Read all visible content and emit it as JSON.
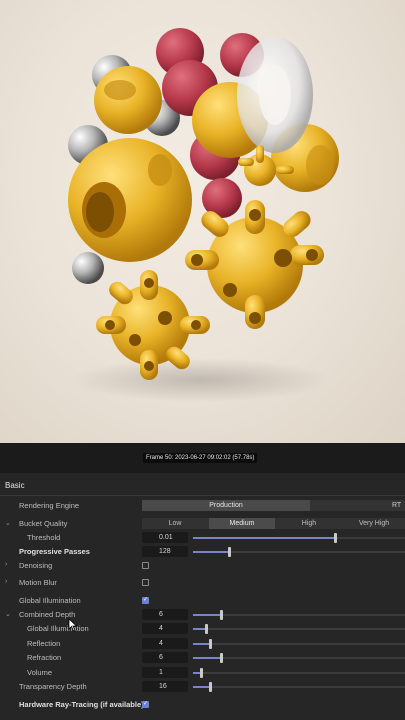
{
  "viewport": {
    "frame_info": "Frame 50: 2023-06-27 09:02:02 (57.78s)"
  },
  "panel": {
    "section_title": "Basic",
    "rendering_engine": {
      "label": "Rendering Engine",
      "value": "Production",
      "alt": "RT"
    },
    "bucket_quality": {
      "label": "Bucket Quality",
      "options": [
        "Low",
        "Medium",
        "High",
        "Very High"
      ],
      "selected": "Medium"
    },
    "threshold": {
      "label": "Threshold",
      "value": "0.01",
      "slider_fraction": 0.67
    },
    "progressive_passes": {
      "label": "Progressive Passes",
      "value": "128",
      "slider_fraction": 0.17
    },
    "denoising": {
      "label": "Denoising",
      "checked": false
    },
    "motion_blur": {
      "label": "Motion Blur",
      "checked": false
    },
    "global_illumination": {
      "label": "Global Illumination",
      "checked": true
    },
    "combined_depth": {
      "label": "Combined Depth",
      "value": "6",
      "slider_fraction": 0.13
    },
    "gi_depth": {
      "label": "Global Illumination",
      "value": "4",
      "slider_fraction": 0.06
    },
    "reflection": {
      "label": "Reflection",
      "value": "4",
      "slider_fraction": 0.08
    },
    "refraction": {
      "label": "Refraction",
      "value": "6",
      "slider_fraction": 0.13
    },
    "volume": {
      "label": "Volume",
      "value": "1",
      "slider_fraction": 0.04
    },
    "transparency_depth": {
      "label": "Transparency Depth",
      "value": "16",
      "slider_fraction": 0.08
    },
    "hardware_rt": {
      "label": "Hardware Ray-Tracing (if available)",
      "checked": true
    }
  },
  "colors": {
    "accent": "#7b84c7",
    "panel_bg": "#262626",
    "yellow": "#e8b52a",
    "red": "#b53a4a"
  },
  "icons": [
    "chevron-down-icon",
    "chevron-right-icon",
    "checkbox-icon",
    "mouse-cursor-icon"
  ]
}
